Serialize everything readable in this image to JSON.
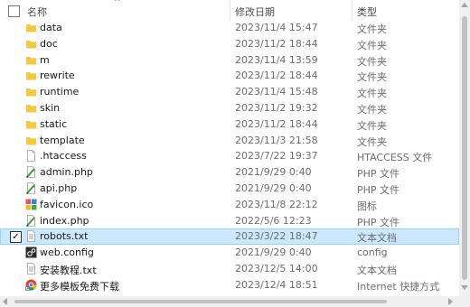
{
  "columns": {
    "name": "名称",
    "date": "修改日期",
    "type": "类型"
  },
  "colors": {
    "folder": "#f3c744",
    "selection": "#cce8ff",
    "selection_border": "#99d1ff"
  },
  "files": [
    {
      "name": "data",
      "date": "2023/11/4 15:47",
      "type": "文件夹",
      "icon": "folder-icon"
    },
    {
      "name": "doc",
      "date": "2023/11/2 18:44",
      "type": "文件夹",
      "icon": "folder-icon"
    },
    {
      "name": "m",
      "date": "2023/11/4 13:59",
      "type": "文件夹",
      "icon": "folder-icon"
    },
    {
      "name": "rewrite",
      "date": "2023/11/2 18:44",
      "type": "文件夹",
      "icon": "folder-icon"
    },
    {
      "name": "runtime",
      "date": "2023/11/4 15:48",
      "type": "文件夹",
      "icon": "folder-icon"
    },
    {
      "name": "skin",
      "date": "2023/11/2 19:32",
      "type": "文件夹",
      "icon": "folder-icon"
    },
    {
      "name": "static",
      "date": "2023/11/2 18:44",
      "type": "文件夹",
      "icon": "folder-icon"
    },
    {
      "name": "template",
      "date": "2023/11/3 21:58",
      "type": "文件夹",
      "icon": "folder-icon"
    },
    {
      "name": ".htaccess",
      "date": "2023/7/22 19:37",
      "type": "HTACCESS 文件",
      "icon": "blank-file-icon"
    },
    {
      "name": "admin.php",
      "date": "2021/9/29 0:40",
      "type": "PHP 文件",
      "icon": "php-file-icon"
    },
    {
      "name": "api.php",
      "date": "2021/9/29 0:40",
      "type": "PHP 文件",
      "icon": "php-file-icon"
    },
    {
      "name": "favicon.ico",
      "date": "2023/11/8 22:12",
      "type": "图标",
      "icon": "ico-file-icon"
    },
    {
      "name": "index.php",
      "date": "2022/5/6 12:23",
      "type": "PHP 文件",
      "icon": "php-file-icon"
    },
    {
      "name": "robots.txt",
      "date": "2023/3/22 18:47",
      "type": "文本文档",
      "icon": "text-file-icon",
      "selected": true
    },
    {
      "name": "web.config",
      "date": "2021/9/29 0:40",
      "type": "config",
      "icon": "config-file-icon"
    },
    {
      "name": "安装教程.txt",
      "date": "2023/12/5 14:00",
      "type": "文本文档",
      "icon": "text-file-icon"
    },
    {
      "name": "更多模板免费下载",
      "date": "2023/12/4 18:51",
      "type": "Internet 快捷方式",
      "icon": "chrome-shortcut-icon"
    }
  ]
}
